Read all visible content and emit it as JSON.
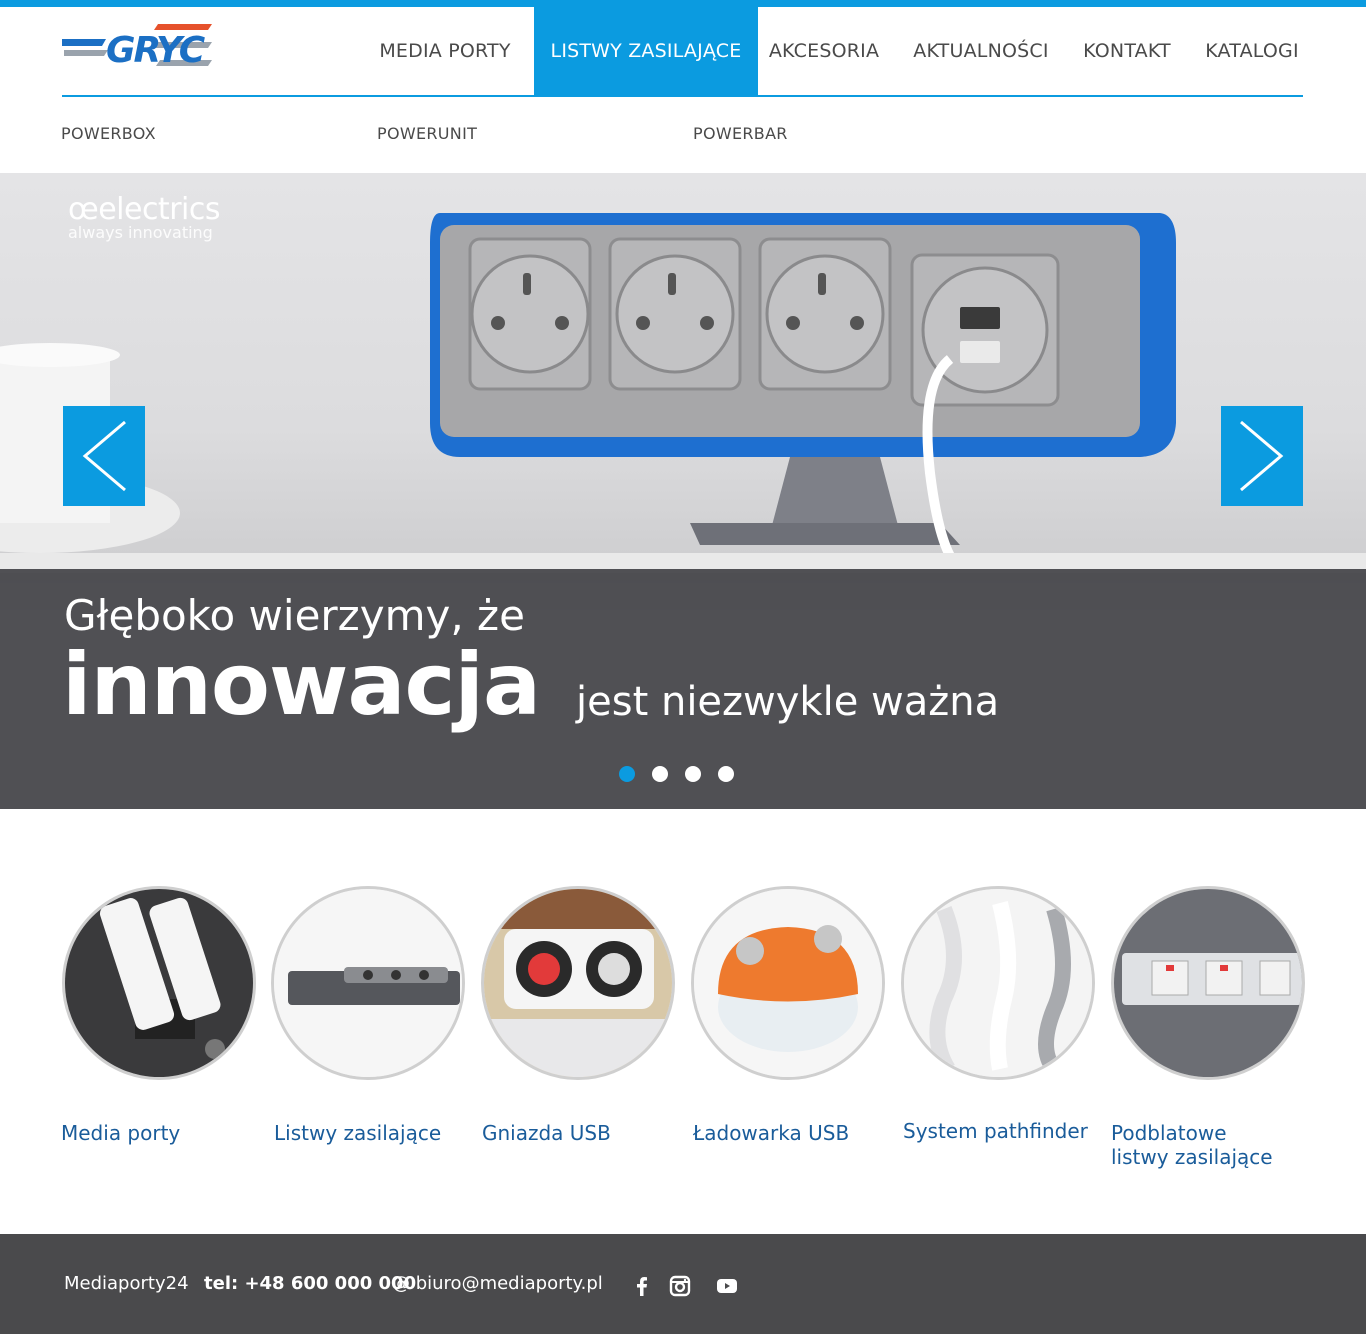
{
  "brand": {
    "logo_text": "GRYC"
  },
  "nav": {
    "items": [
      {
        "label": "MEDIA PORTY"
      },
      {
        "label": "LISTWY ZASILAJĄCE",
        "active": true
      },
      {
        "label": "AKCESORIA"
      },
      {
        "label": "AKTUALNOŚCI"
      },
      {
        "label": "KONTAKT"
      },
      {
        "label": "KATALOGI"
      }
    ],
    "submenu": [
      "POWERBOX",
      "POWERUNIT",
      "POWERBAR"
    ]
  },
  "hero": {
    "brand_mark": {
      "name": "œelectrics",
      "tagline": "always innovating"
    },
    "caption_line1": "Głęboko wierzymy, że",
    "caption_big": "innowacja",
    "caption_rest": "jest niezwykle ważna",
    "prev_icon": "chevron-left-icon",
    "next_icon": "chevron-right-icon",
    "slides_count": 4,
    "active_slide": 1
  },
  "categories": [
    {
      "label": "Media porty"
    },
    {
      "label": "Listwy zasilające"
    },
    {
      "label": "Gniazda USB"
    },
    {
      "label": "Ładowarka USB"
    },
    {
      "label": "System pathfinder"
    },
    {
      "label_line1": "Podblatowe",
      "label_line2": "listwy zasilające"
    }
  ],
  "footer": {
    "company": "Mediaporty24",
    "phone": "tel: +48 600 000 000",
    "email": "@ biuro@mediaporty.pl",
    "social": [
      "facebook-icon",
      "instagram-icon",
      "youtube-icon"
    ]
  },
  "colors": {
    "accent": "#0b9be0",
    "link": "#1a5c9a",
    "footer_bg": "#4a4a4c",
    "logo_red": "#e6512b",
    "logo_blue": "#1b6fc4"
  }
}
